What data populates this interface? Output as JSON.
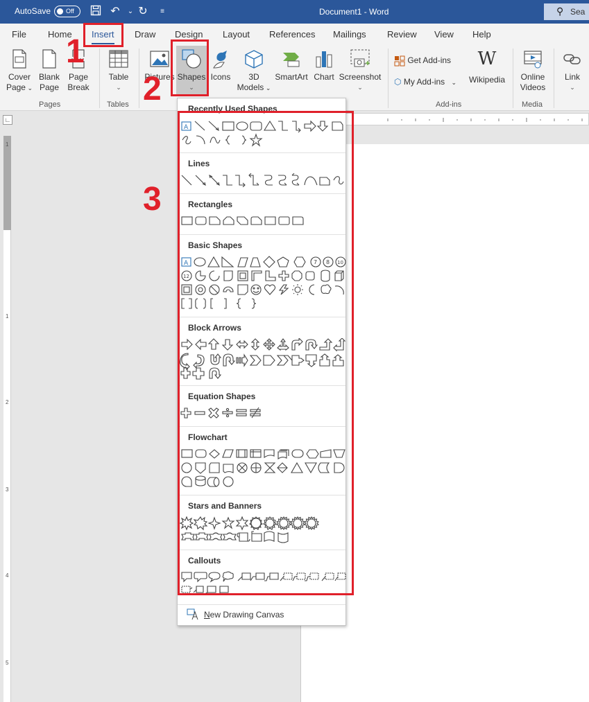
{
  "titlebar": {
    "autosave_label": "AutoSave",
    "toggle_state": "Off",
    "document_title": "Document1 - Word",
    "search_partial": "Sea"
  },
  "tabs": [
    "File",
    "Home",
    "Insert",
    "Draw",
    "Design",
    "Layout",
    "References",
    "Mailings",
    "Review",
    "View",
    "Help"
  ],
  "active_tab": "Insert",
  "ribbon": {
    "cover_page": [
      "Cover",
      "Page"
    ],
    "blank_page": [
      "Blank",
      "Page"
    ],
    "page_break": [
      "Page",
      "Break"
    ],
    "table": "Table",
    "pictures": "Pictures",
    "shapes": "Shapes",
    "icons": "Icons",
    "models_3d": [
      "3D",
      "Models"
    ],
    "smartart": "SmartArt",
    "chart": "Chart",
    "screenshot": "Screenshot",
    "get_addins": "Get Add-ins",
    "my_addins": "My Add-ins",
    "wikipedia": "Wikipedia",
    "online_videos": [
      "Online",
      "Videos"
    ],
    "link": "Link",
    "groups": [
      "Pages",
      "Tables",
      "Add-ins",
      "Media"
    ]
  },
  "dropdown": {
    "sections": [
      "Recently Used Shapes",
      "Lines",
      "Rectangles",
      "Basic Shapes",
      "Block Arrows",
      "Equation Shapes",
      "Flowchart",
      "Stars and Banners",
      "Callouts"
    ],
    "new_canvas": "New Drawing Canvas"
  },
  "annotations": [
    "1",
    "2",
    "3"
  ],
  "ruler_numbers": [
    "1",
    "1",
    "2",
    "3",
    "4",
    "5"
  ],
  "colors": {
    "title_bar": "#2b579a",
    "annotation_red": "#e0202a",
    "ribbon_bg": "#f3f3f3"
  }
}
